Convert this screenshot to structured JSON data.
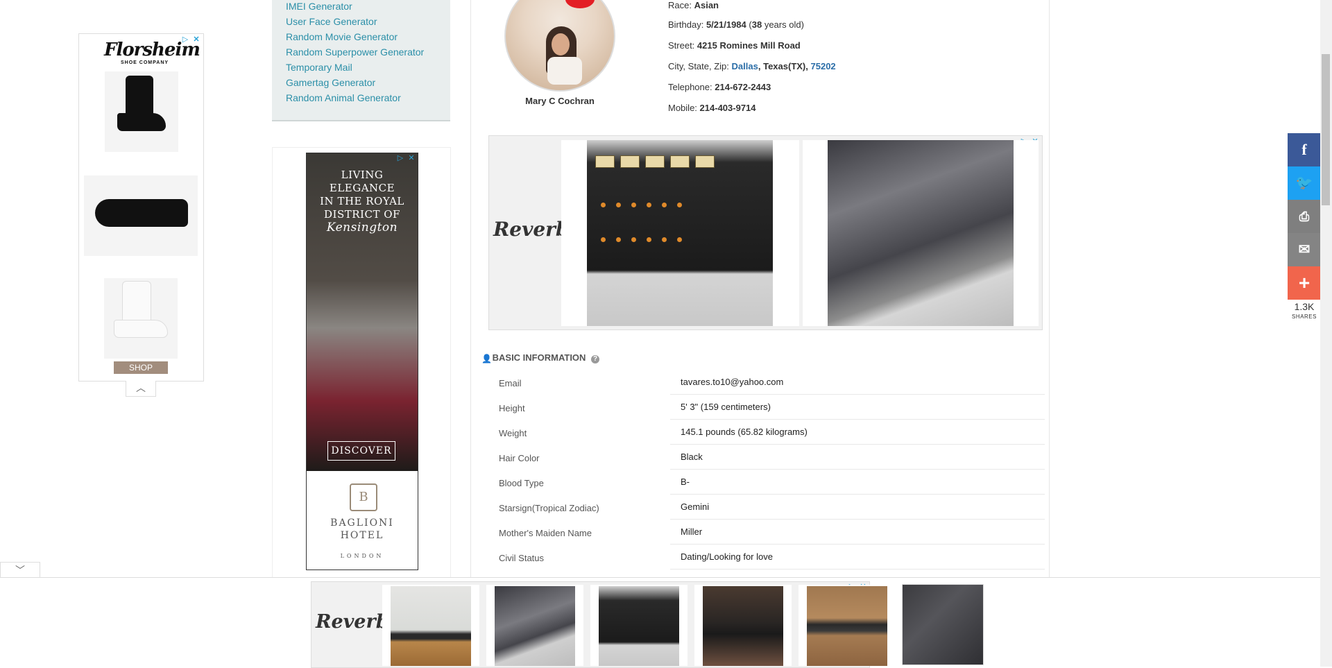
{
  "sidebar": {
    "links": [
      "IMEI Generator",
      "User Face Generator",
      "Random Movie Generator",
      "Random Superpower Generator",
      "Temporary Mail",
      "Gamertag Generator",
      "Random Animal Generator"
    ]
  },
  "left_ad": {
    "brand": "Florsheim",
    "brand_sub": "SHOE COMPANY",
    "shop_label": "SHOP"
  },
  "hotel_ad": {
    "headline_lines": [
      "LIVING",
      "ELEGANCE",
      "IN THE ROYAL",
      "DISTRICT OF",
      "Kensington"
    ],
    "cta": "DISCOVER",
    "name_lines": [
      "BAGLIONI",
      "HOTEL"
    ],
    "location": "LONDON",
    "crest": "B"
  },
  "profile": {
    "name": "Mary C Cochran",
    "race_label": "Race:",
    "race": "Asian",
    "birthday_label": "Birthday:",
    "birthday": "5/21/1984",
    "age": "38",
    "age_suffix": "years old)",
    "street_label": "Street:",
    "street": "4215 Romines Mill Road",
    "city_label": "City, State, Zip:",
    "city": "Dallas",
    "state": "Texas(TX)",
    "zip": "75202",
    "telephone_label": "Telephone:",
    "telephone": "214-672-2443",
    "mobile_label": "Mobile:",
    "mobile": "214-403-9714"
  },
  "reverb_logo": "Reverb",
  "basic_info": {
    "title": "BASIC INFORMATION",
    "rows": [
      {
        "label": "Email",
        "value": "tavares.to10@yahoo.com"
      },
      {
        "label": "Height",
        "value": "5' 3\" (159 centimeters)"
      },
      {
        "label": "Weight",
        "value": "145.1 pounds (65.82 kilograms)"
      },
      {
        "label": "Hair Color",
        "value": "Black"
      },
      {
        "label": "Blood Type",
        "value": "B-"
      },
      {
        "label": "Starsign(Tropical Zodiac)",
        "value": "Gemini"
      },
      {
        "label": "Mother's Maiden Name",
        "value": "Miller"
      },
      {
        "label": "Civil Status",
        "value": "Dating/Looking for love"
      }
    ]
  },
  "share": {
    "count": "1.3K",
    "label": "SHARES",
    "colors": {
      "facebook": "#3b5998",
      "twitter": "#1da1f2",
      "print": "#7f7f7f",
      "email": "#848484",
      "more": "#f1654c"
    }
  },
  "icons": [
    "adchoices-icon",
    "close-icon",
    "chevron-up-icon",
    "chevron-down-icon",
    "user-icon",
    "help-icon",
    "facebook-icon",
    "twitter-icon",
    "print-icon",
    "email-icon",
    "plus-icon"
  ]
}
